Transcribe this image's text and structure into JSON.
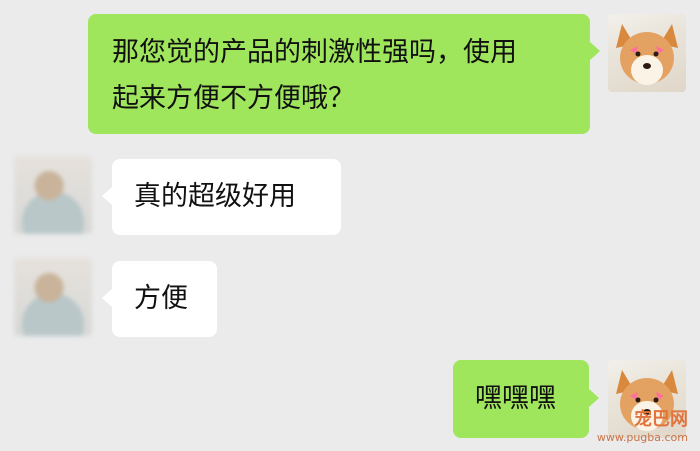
{
  "messages": [
    {
      "side": "right",
      "text_line1": "那您觉的产品的刺激性强吗，使用",
      "text_line2": "起来方便不方便哦？"
    },
    {
      "side": "left",
      "text": "真的超级好用"
    },
    {
      "side": "left",
      "text": "方便"
    },
    {
      "side": "right",
      "text": "嘿嘿嘿"
    }
  ],
  "watermark": {
    "brand": "宠巴网",
    "url": "www.pugba.com"
  },
  "colors": {
    "background": "#ebebeb",
    "sent_bubble": "#9fe65c",
    "received_bubble": "#ffffff",
    "watermark": "#e0743c"
  }
}
